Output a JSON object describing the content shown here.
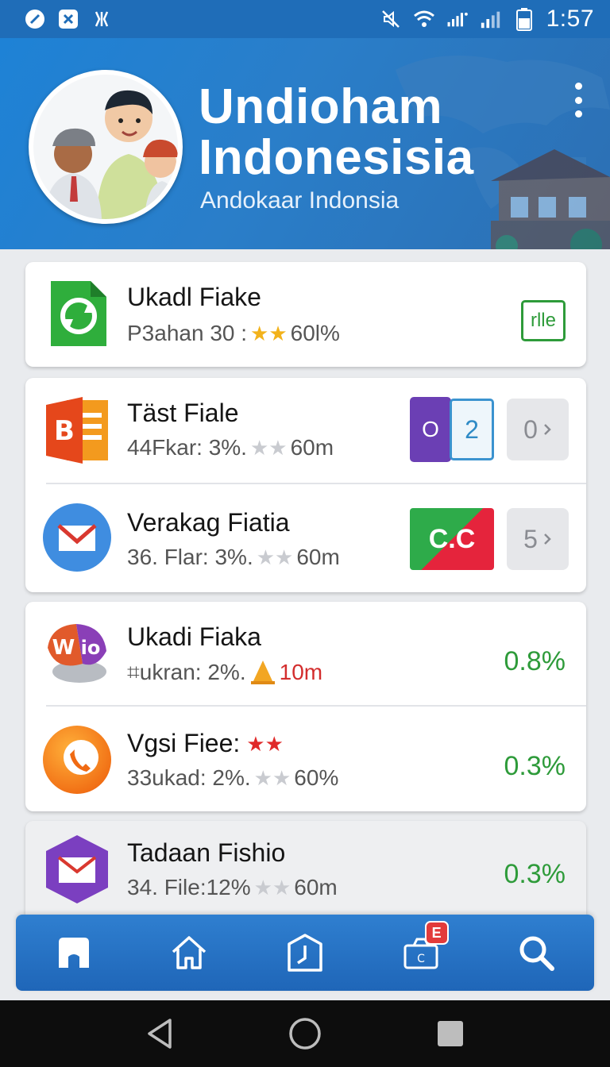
{
  "status_bar": {
    "time": "1:57",
    "left_icons": [
      "slash-circle-icon",
      "x-box-icon",
      "link-icon"
    ],
    "right_icons": [
      "mute-icon",
      "wifi-icon",
      "signal-icon",
      "signal-icon",
      "battery-icon"
    ]
  },
  "header": {
    "title_line1": "Undioham",
    "title_line2": "Indonesisia",
    "subtitle": "Andokaar Indonsia",
    "menu_icon": "kebab-menu-icon"
  },
  "items": [
    {
      "title": "Ukadl Fiake",
      "meta_prefix": "P3ahan 30 :",
      "meta_suffix": "60l%",
      "stars": "★★",
      "icon": "green-sync-file-icon",
      "badge_text": "rlle",
      "colors": {
        "icon": "#2fae3c"
      }
    },
    {
      "title": "Täst Fiale",
      "meta_prefix": "44Fkar: 3%.",
      "meta_suffix": "60m",
      "stars": "★★",
      "icon": "orange-document-icon",
      "badge_left": "O",
      "badge_right": "2",
      "chip": "0"
    },
    {
      "title": "Verakag Fiatia",
      "meta_prefix": "36. Flar: 3%.",
      "meta_suffix": "60m",
      "stars": "★★",
      "icon": "mail-envelope-icon",
      "badge_text": "C.C",
      "chip": "5"
    },
    {
      "title": "Ukadi Fiaka",
      "meta_prefix": "⌗ukran: 2%.",
      "meta_suffix": "10m",
      "icon": "wio-app-icon",
      "warn_icon": "warning-cone-icon",
      "percent": "0.8%"
    },
    {
      "title": "Vgsi Fiee:",
      "meta_prefix": "33ukad: 2%.",
      "meta_suffix": "60%",
      "stars": "★★",
      "title_stars": "★★",
      "icon": "phone-call-icon",
      "percent": "0.3%"
    },
    {
      "title": "Tadaan Fishio",
      "meta_prefix": "34. File:12%",
      "meta_suffix": "60m",
      "stars": "★★",
      "icon": "purple-mail-icon",
      "percent": "0.3%"
    }
  ],
  "bottom_nav": {
    "items": [
      "home-filled-icon",
      "home-outline-icon",
      "clock-icon",
      "store-icon",
      "search-icon"
    ],
    "badge": "E"
  },
  "system_nav": [
    "back-icon",
    "home-circle-icon",
    "recents-icon"
  ]
}
